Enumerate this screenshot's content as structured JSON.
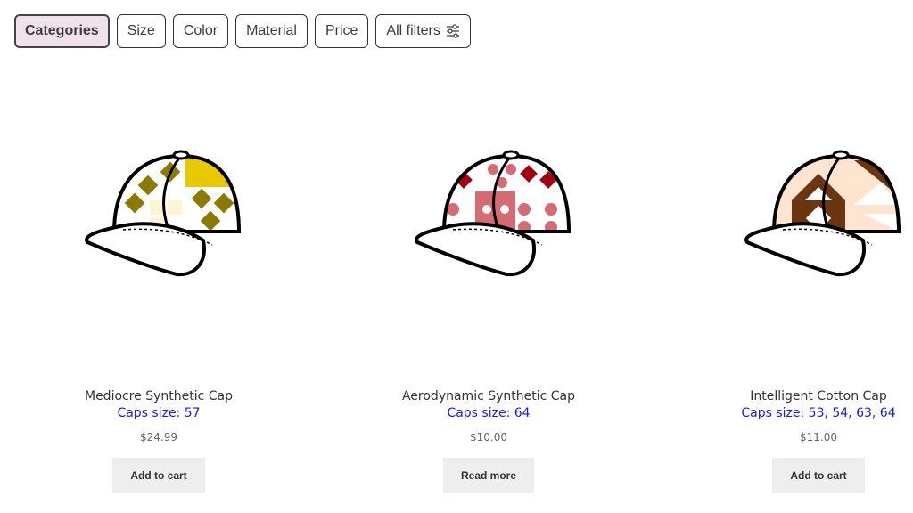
{
  "filters": {
    "categories": "Categories",
    "size": "Size",
    "color": "Color",
    "material": "Material",
    "price": "Price",
    "all_filters": "All filters",
    "all_filters_icon": "sliders-icon"
  },
  "products": [
    {
      "title": "Mediocre Synthetic Cap",
      "meta": "Caps size: 57",
      "price": "$24.99",
      "button": "Add to cart",
      "colors": {
        "pattern": "#8a7a00",
        "accent": "#e8c800",
        "light": "#fff5d0"
      }
    },
    {
      "title": "Aerodynamic Synthetic Cap",
      "meta": "Caps size: 64",
      "price": "$10.00",
      "button": "Read more",
      "colors": {
        "pattern": "#d66b73",
        "accent": "#a00010",
        "light": "#ffffff"
      }
    },
    {
      "title": "Intelligent Cotton Cap",
      "meta": "Caps size: 53, 54, 63, 64",
      "price": "$11.00",
      "button": "Add to cart",
      "colors": {
        "pattern": "#6b3510",
        "accent": "#5a2a08",
        "light": "#ffe4d0"
      }
    }
  ],
  "theme": {
    "link": "#1a1ae6",
    "button_bg": "#eeeeee"
  }
}
